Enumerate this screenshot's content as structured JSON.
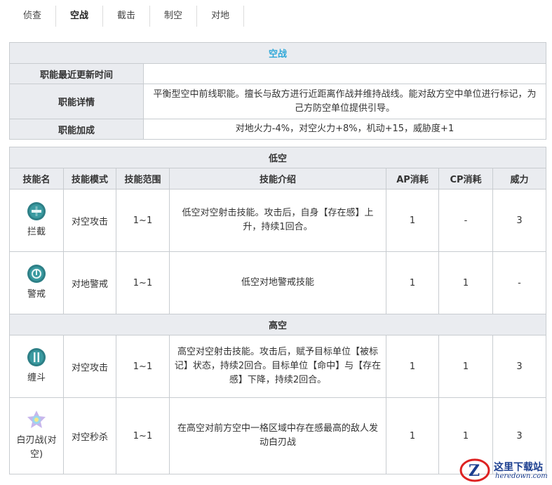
{
  "tabs": [
    "侦查",
    "空战",
    "截击",
    "制空",
    "对地"
  ],
  "active_tab_index": 1,
  "info": {
    "title": "空战",
    "rows": [
      {
        "label": "职能最近更新时间",
        "value": ""
      },
      {
        "label": "职能详情",
        "value": "平衡型空中前线职能。擅长与敌方进行近距离作战并维持战线。能对敌方空中单位进行标记，为己方防空单位提供引导。"
      },
      {
        "label": "职能加成",
        "value": "对地火力-4%，对空火力+8%，机动+15，威胁度+1"
      }
    ]
  },
  "skills": {
    "columns": [
      "技能名",
      "技能模式",
      "技能范围",
      "技能介绍",
      "AP消耗",
      "CP消耗",
      "威力"
    ],
    "low": {
      "title": "低空",
      "rows": [
        {
          "icon": "interception-skill-icon",
          "name": "拦截",
          "mode": "对空攻击",
          "range": "1~1",
          "desc": "低空对空射击技能。攻击后，自身【存在感】上升，持续1回合。",
          "ap": "1",
          "cp": "-",
          "power": "3"
        },
        {
          "icon": "alert-skill-icon",
          "name": "警戒",
          "mode": "对地警戒",
          "range": "1~1",
          "desc": "低空对地警戒技能",
          "ap": "1",
          "cp": "1",
          "power": "-"
        }
      ]
    },
    "high": {
      "title": "高空",
      "rows": [
        {
          "icon": "dogfight-skill-icon",
          "name": "缠斗",
          "mode": "对空攻击",
          "range": "1~1",
          "desc": "高空对空射击技能。攻击后，赋予目标单位【被标记】状态，持续2回合。目标单位【命中】与【存在感】下降，持续2回合。",
          "ap": "1",
          "cp": "1",
          "power": "3"
        },
        {
          "icon": "melee-skill-icon",
          "name": "白刃战(对空)",
          "mode": "对空秒杀",
          "range": "1~1",
          "desc": "在高空对前方空中一格区域中存在感最高的敌人发动白刃战",
          "ap": "1",
          "cp": "1",
          "power": "3"
        }
      ]
    }
  },
  "watermark": {
    "title": "这里下载站",
    "url": "heredown.com"
  },
  "colors": {
    "header_bg": "#eaecf0",
    "title_accent": "#2fa8d8",
    "icon_teal": "#2d7f86",
    "border": "#c8ccd0"
  }
}
